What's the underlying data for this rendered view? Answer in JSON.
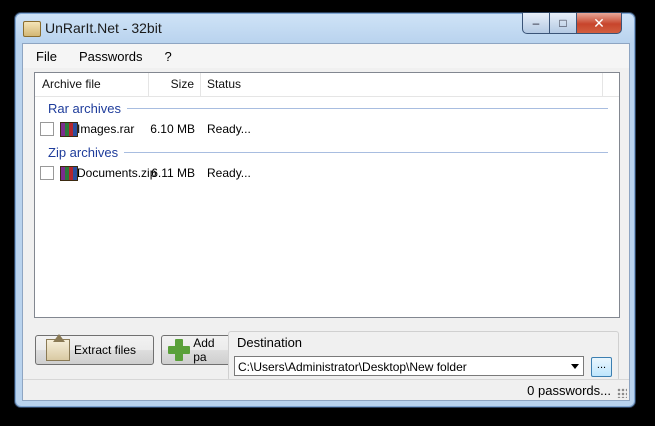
{
  "window": {
    "title": "UnRarIt.Net - 32bit"
  },
  "controls": {
    "minimize": "–",
    "maximize": "□",
    "close": "✕"
  },
  "menu": [
    "File",
    "Passwords",
    "?"
  ],
  "list": {
    "columns": [
      "Archive file",
      "Size",
      "Status"
    ],
    "groups": [
      {
        "name": "Rar archives",
        "items": [
          {
            "file": "Images.rar",
            "size": "6.10 MB",
            "status": "Ready..."
          }
        ]
      },
      {
        "name": "Zip archives",
        "items": [
          {
            "file": "Documents.zip",
            "size": "6.11 MB",
            "status": "Ready..."
          }
        ]
      }
    ]
  },
  "buttons": {
    "extract": "Extract files",
    "add_password": "Add pa"
  },
  "destination": {
    "label": "Destination",
    "path": "C:\\Users\\Administrator\\Desktop\\New folder",
    "browse": "..."
  },
  "status": {
    "text": "0 passwords..."
  }
}
